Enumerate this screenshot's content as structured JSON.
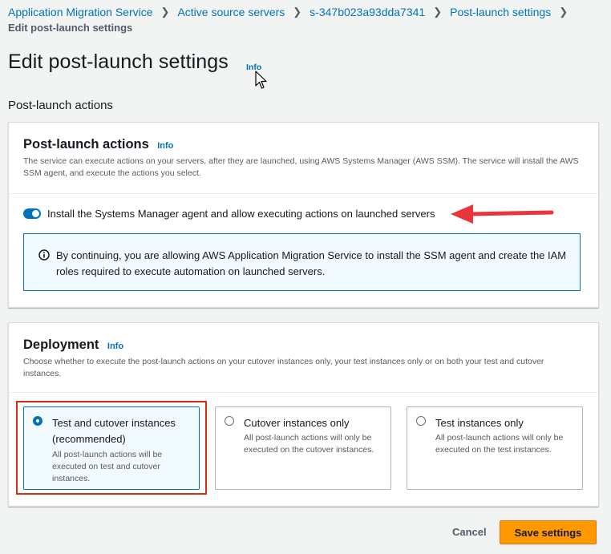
{
  "breadcrumb": {
    "items": [
      "Application Migration Service",
      "Active source servers",
      "s-347b023a93dda7341",
      "Post-launch settings"
    ],
    "current": "Edit post-launch settings"
  },
  "page": {
    "title": "Edit post-launch settings",
    "info_label": "Info",
    "section_heading": "Post-launch actions"
  },
  "post_launch_panel": {
    "title": "Post-launch actions",
    "info_label": "Info",
    "description": "The service can execute actions on your servers, after they are launched, using AWS Systems Manager (AWS SSM). The service will install the AWS SSM agent, and execute the actions you select.",
    "toggle_label": "Install the Systems Manager agent and allow executing actions on launched servers",
    "toggle_on": true,
    "alert_text": "By continuing, you are allowing AWS Application Migration Service to install the SSM agent and create the IAM roles required to execute automation on launched servers."
  },
  "deployment_panel": {
    "title": "Deployment",
    "info_label": "Info",
    "description": "Choose whether to execute the post-launch actions on your cutover instances only, your test instances only or on both your test and cutover instances.",
    "options": [
      {
        "label": "Test and cutover instances (recommended)",
        "description": "All post-launch actions will be executed on test and cutover instances.",
        "selected": true
      },
      {
        "label": "Cutover instances only",
        "description": "All post-launch actions will only be executed on the cutover instances.",
        "selected": false
      },
      {
        "label": "Test instances only",
        "description": "All post-launch actions will only be executed on the test instances.",
        "selected": false
      }
    ]
  },
  "footer": {
    "cancel_label": "Cancel",
    "save_label": "Save settings"
  },
  "colors": {
    "link": "#0073bb",
    "primary_button": "#ff9900",
    "annotation": "#d13212"
  },
  "icons": [
    "chevron-right-icon",
    "cursor-icon",
    "info-circle-icon",
    "red-arrow-annotation"
  ]
}
